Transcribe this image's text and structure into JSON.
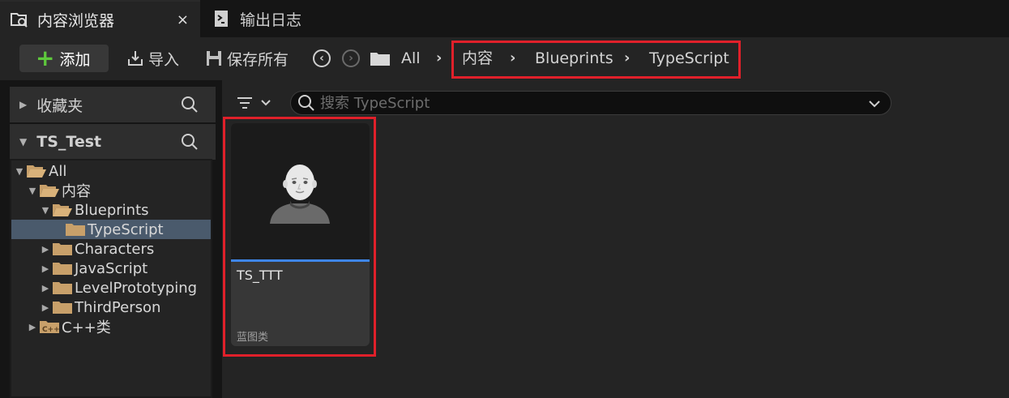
{
  "tabs": {
    "content_browser": "内容浏览器",
    "close": "×",
    "output_log": "输出日志"
  },
  "toolbar": {
    "add_label": "添加",
    "import_label": "导入",
    "save_all_label": "保存所有",
    "breadcrumb_root": "All",
    "breadcrumbs": [
      "内容",
      "Blueprints",
      "TypeScript"
    ],
    "separator": "›"
  },
  "sidebar": {
    "favorites_label": "收藏夹",
    "project_label": "TS_Test",
    "tree": [
      {
        "label": "All",
        "expanded": true,
        "selected": false
      },
      {
        "label": "内容",
        "expanded": true,
        "selected": false
      },
      {
        "label": "Blueprints",
        "expanded": true,
        "selected": false
      },
      {
        "label": "TypeScript",
        "expanded": false,
        "selected": true
      },
      {
        "label": "Characters",
        "expanded": false,
        "selected": false
      },
      {
        "label": "JavaScript",
        "expanded": false,
        "selected": false
      },
      {
        "label": "LevelPrototyping",
        "expanded": false,
        "selected": false
      },
      {
        "label": "ThirdPerson",
        "expanded": false,
        "selected": false
      },
      {
        "label": "C++类",
        "expanded": false,
        "selected": false
      }
    ]
  },
  "content": {
    "search_placeholder": "搜索 TypeScript",
    "search_value": "",
    "assets": [
      {
        "name": "TS_TTT",
        "type": "蓝图类",
        "icon": "character-bust-icon"
      }
    ]
  },
  "colors": {
    "highlight": "#e0202a",
    "add_plus": "#5ec83c",
    "asset_bar": "#3f86e8",
    "folder": "#c8a06a",
    "selected_row": "#4a5a6c"
  }
}
